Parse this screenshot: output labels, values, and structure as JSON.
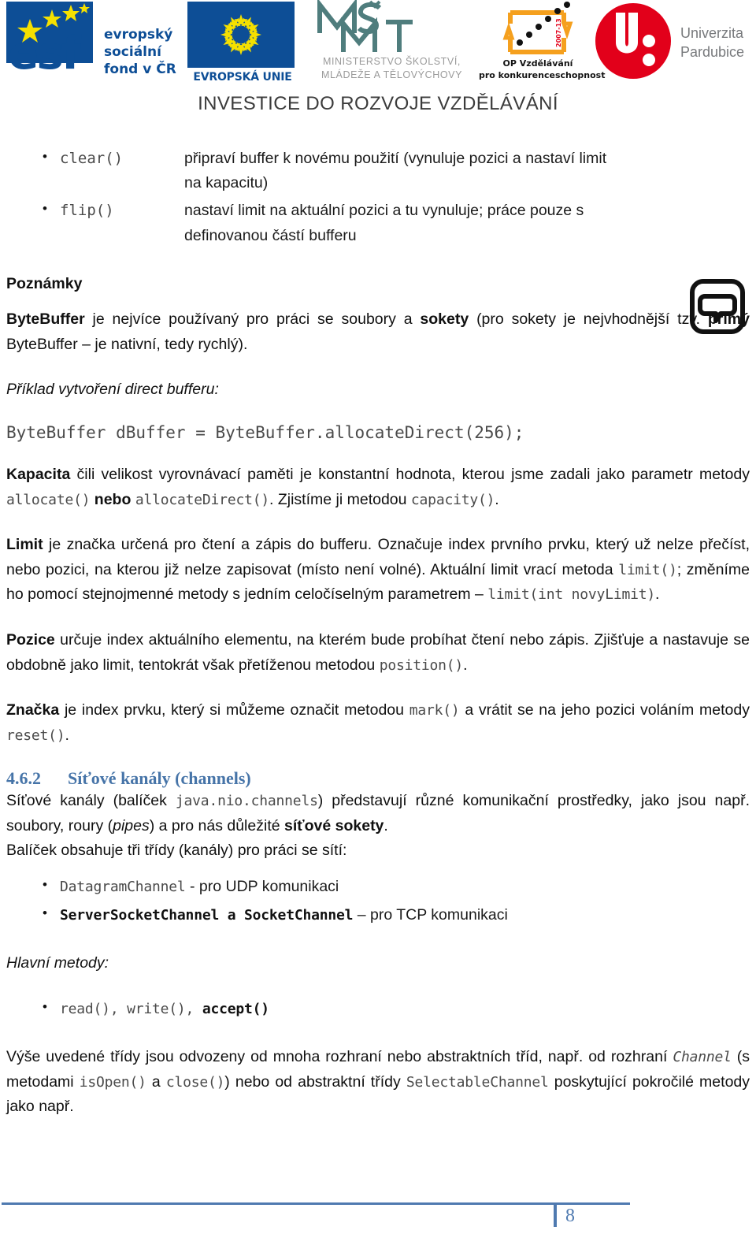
{
  "header": {
    "logos": [
      {
        "name": "esf-logo",
        "letters": "esf",
        "lines": [
          "evropský",
          "sociální",
          "fond v ČR"
        ]
      },
      {
        "name": "eu-logo",
        "caption": "EVROPSKÁ UNIE"
      },
      {
        "name": "msmt-logo",
        "monogram": "MŠMT",
        "lines": [
          "MINISTERSTVO ŠKOLSTVÍ,",
          "MLÁDEŽE A TĚLOVÝCHOVY"
        ]
      },
      {
        "name": "op-vzdelavani-logo",
        "lines": [
          "OP Vzdělávání",
          "pro konkurenceschopnost"
        ],
        "side_text": "2007-13"
      },
      {
        "name": "univerzita-pardubice-logo",
        "lines": [
          "Univerzita",
          "Pardubice"
        ]
      }
    ],
    "tagline": "INVESTICE DO ROZVOJE VZDĚLÁVÁNÍ",
    "colors": {
      "eu_blue": "#0d4e96",
      "star_yellow": "#f5e000",
      "msmt_teal": "#4f7d7d",
      "opvk_orange": "#f5a01e",
      "upce_red": "#e2001a",
      "heading_blue": "#4674a8"
    }
  },
  "methods_list": [
    {
      "name": "clear()",
      "desc": "připraví buffer k novému použití (vynuluje pozici a nastaví limit na kapacitu)"
    },
    {
      "name": "flip()",
      "desc": "nastaví limit na aktuální pozici a tu vynuluje; práce pouze s definovanou částí bufferu"
    }
  ],
  "notes": {
    "heading": "Poznámky",
    "icon": "comment-bubble-icon",
    "intro": {
      "b1": "ByteBuffer",
      "t1": " je nejvíce používaný pro práci se soubory a ",
      "b2": "sokety",
      "t2": " (pro sokety je nejvhodnější tzv. ",
      "b3": "přímý",
      "t3": " ByteBuffer – je nativní, tedy rychlý)."
    },
    "example_caption": "Příklad vytvoření direct bufferu:",
    "example_code": "ByteBuffer dBuffer = ByteBuffer.allocateDirect(256);"
  },
  "paragraphs": {
    "kapacita": {
      "b1": "Kapacita",
      "t1": " čili velikost vyrovnávací paměti je konstantní hodnota, kterou jsme zadali jako parametr metody ",
      "c1": "allocate()",
      "t2": " ",
      "b2": "nebo",
      "t3": " ",
      "c2": "allocateDirect()",
      "t4": ". Zjistíme ji metodou ",
      "c3": "capacity()",
      "t5": "."
    },
    "limit": {
      "b1": "Limit",
      "t1": " je značka určená pro čtení a zápis do bufferu. Označuje index prvního prvku, který už nelze přečíst, nebo pozici, na kterou již nelze zapisovat (místo není volné). Aktuální limit vrací metoda ",
      "c1": "limit()",
      "t2": "; změníme ho pomocí stejnojmenné metody s jedním celočíselným parametrem – ",
      "c2": "limit(int novyLimit)",
      "t3": "."
    },
    "pozice": {
      "b1": "Pozice",
      "t1": " určuje index aktuálního elementu, na kterém bude probíhat čtení nebo zápis. Zjišťuje a nastavuje se obdobně jako limit, tentokrát však přetíženou metodou ",
      "c1": "position()",
      "t2": "."
    },
    "znacka": {
      "b1": "Značka",
      "t1": " je index prvku, který si můžeme označit metodou ",
      "c1": "mark()",
      "t2": " a vrátit se na jeho pozici voláním metody ",
      "c2": "reset()",
      "t3": "."
    }
  },
  "section": {
    "number": "4.6.2",
    "title": "Síťové kanály (channels)",
    "intro": {
      "t1": "Síťové kanály (balíček ",
      "c1": "java.nio.channels",
      "t2": ") představují různé komunikační prostředky, jako jsou např. soubory, roury (",
      "i1": "pipes",
      "t3": ") a pro nás důležité ",
      "b1": "síťové sokety",
      "t4": "."
    },
    "classes_lead": "Balíček obsahuje tři třídy (kanály) pro práci se sítí:",
    "classes": [
      {
        "code": "DatagramChannel",
        "bold": false,
        "desc": " - pro UDP komunikaci"
      },
      {
        "code": "ServerSocketChannel a SocketChannel",
        "bold": true,
        "desc": " – pro TCP komunikaci"
      }
    ],
    "methods_caption": "Hlavní metody:",
    "methods_item": {
      "c1": "read(), write(), ",
      "c2": "accept()"
    },
    "outro": {
      "t1": "Výše uvedené třídy jsou odvozeny od mnoha rozhraní nebo abstraktních tříd, např. od rozhraní ",
      "c1": "Channel",
      "t2": " (s metodami ",
      "c2": "isOpen()",
      "t3": " a ",
      "c3": "close()",
      "t4": ") nebo od abstraktní třídy ",
      "c4": "SelectableChannel",
      "t5": " poskytující pokročilé metody jako např."
    }
  },
  "footer": {
    "page_number": "8"
  }
}
